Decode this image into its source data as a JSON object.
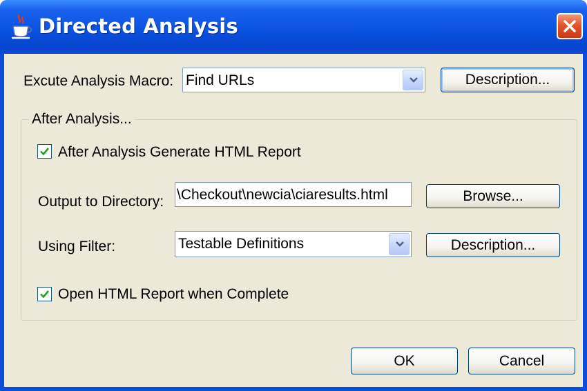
{
  "window": {
    "title": "Directed Analysis"
  },
  "macro": {
    "label": "Excute Analysis Macro:",
    "selected": "Find URLs",
    "description_button": "Description..."
  },
  "after_analysis": {
    "group_title": "After Analysis...",
    "generate_report_label": "After Analysis Generate HTML Report",
    "generate_report_checked": true,
    "output_dir_label": "Output to Directory:",
    "output_dir_value": "\\Checkout\\newcia\\ciaresults.html",
    "browse_button": "Browse...",
    "filter_label": "Using Filter:",
    "filter_selected": "Testable Definitions",
    "filter_description_button": "Description...",
    "open_report_label": "Open HTML Report when Complete",
    "open_report_checked": true
  },
  "footer": {
    "ok_button": "OK",
    "cancel_button": "Cancel"
  },
  "colors": {
    "title_bar": "#0a52e0",
    "client_background": "#ece9d8",
    "close_button": "#e2552c",
    "checkmark": "#21a121"
  },
  "icons": {
    "title": "java-coffee-cup-icon",
    "close": "close-icon",
    "dropdown": "chevron-down-icon",
    "check": "checkmark-icon"
  }
}
